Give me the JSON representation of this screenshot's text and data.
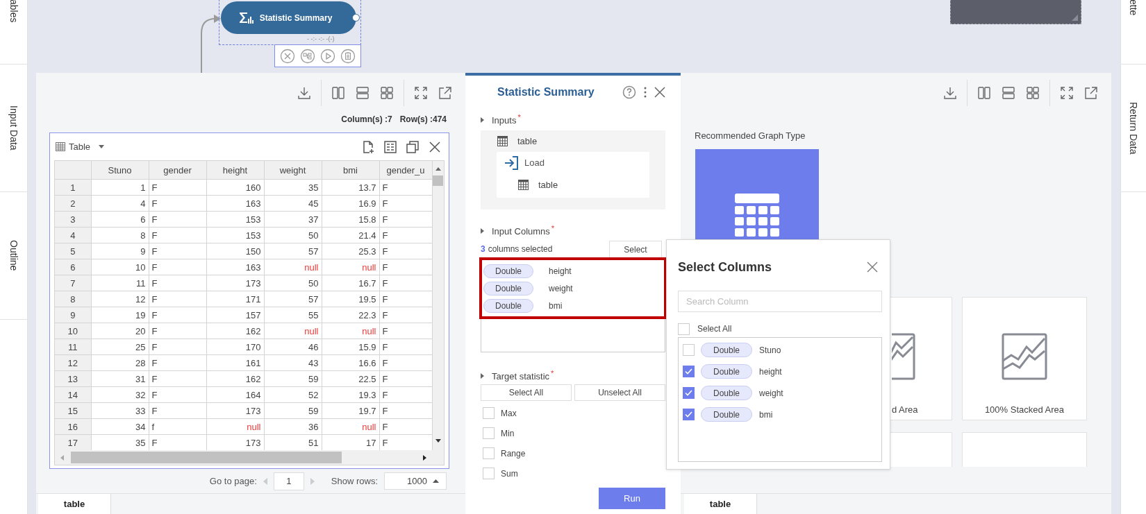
{
  "left_sidebar": {
    "tabs": [
      {
        "label": "ables"
      },
      {
        "label": "Input Data"
      },
      {
        "label": "Outline"
      }
    ]
  },
  "canvas": {
    "node": {
      "label": "Statistic Summary",
      "status": "- -:- -:- -(-)",
      "selected": true
    }
  },
  "data_panel": {
    "summary": {
      "columns": "Column(s) :7",
      "rows": "Row(s) :474"
    },
    "table_widget": {
      "title": "Table",
      "columns": [
        {
          "label": "Stuno",
          "kind": "number"
        },
        {
          "label": "gender",
          "kind": "text"
        },
        {
          "label": "height",
          "kind": "number"
        },
        {
          "label": "weight",
          "kind": "number"
        },
        {
          "label": "bmi",
          "kind": "number"
        },
        {
          "label": "gender_u",
          "kind": "text"
        }
      ],
      "rows": [
        {
          "index": "1",
          "cells": [
            "1",
            "F",
            "160",
            "35",
            "13.7",
            "F"
          ]
        },
        {
          "index": "2",
          "cells": [
            "4",
            "F",
            "163",
            "45",
            "16.9",
            "F"
          ]
        },
        {
          "index": "3",
          "cells": [
            "6",
            "F",
            "153",
            "37",
            "15.8",
            "F"
          ]
        },
        {
          "index": "4",
          "cells": [
            "8",
            "F",
            "153",
            "50",
            "21.4",
            "F"
          ]
        },
        {
          "index": "5",
          "cells": [
            "9",
            "F",
            "150",
            "57",
            "25.3",
            "F"
          ]
        },
        {
          "index": "6",
          "cells": [
            "10",
            "F",
            "163",
            {
              "text": "null",
              "missing": true
            },
            {
              "text": "null",
              "missing": true
            },
            "F"
          ]
        },
        {
          "index": "7",
          "cells": [
            "11",
            "F",
            "173",
            "50",
            "16.7",
            "F"
          ]
        },
        {
          "index": "8",
          "cells": [
            "12",
            "F",
            "171",
            "57",
            "19.5",
            "F"
          ]
        },
        {
          "index": "9",
          "cells": [
            "19",
            "F",
            "157",
            "55",
            "22.3",
            "F"
          ]
        },
        {
          "index": "10",
          "cells": [
            "20",
            "F",
            "162",
            {
              "text": "null",
              "missing": true
            },
            {
              "text": "null",
              "missing": true
            },
            "F"
          ]
        },
        {
          "index": "11",
          "cells": [
            "25",
            "F",
            "170",
            "46",
            "15.9",
            "F"
          ]
        },
        {
          "index": "12",
          "cells": [
            "28",
            "F",
            "161",
            "43",
            "16.6",
            "F"
          ]
        },
        {
          "index": "13",
          "cells": [
            "31",
            "F",
            "162",
            "59",
            "22.5",
            "F"
          ]
        },
        {
          "index": "14",
          "cells": [
            "32",
            "F",
            "164",
            "52",
            "19.3",
            "F"
          ]
        },
        {
          "index": "15",
          "cells": [
            "33",
            "F",
            "173",
            "59",
            "19.7",
            "F"
          ]
        },
        {
          "index": "16",
          "cells": [
            "34",
            "f",
            {
              "text": "null",
              "missing": true
            },
            "36",
            {
              "text": "null",
              "missing": true
            },
            "F"
          ]
        },
        {
          "index": "17",
          "cells": [
            "35",
            "F",
            "173",
            "51",
            "17",
            "F"
          ]
        }
      ]
    },
    "pager": {
      "page_label": "Go to page:",
      "page": "1",
      "rows_label": "Show rows:",
      "rows": "1000"
    },
    "bottom_tabs": [
      {
        "label": "table",
        "selected": true
      }
    ]
  },
  "settings_panel": {
    "title": "Statistic Summary",
    "inputs": {
      "label": "Inputs",
      "required_mark": "*",
      "tree": [
        {
          "label": "table",
          "kind": "table",
          "children": [
            {
              "label": "Load",
              "kind": "load",
              "children": [
                {
                  "label": "table",
                  "kind": "table"
                }
              ]
            }
          ]
        }
      ]
    },
    "input_columns": {
      "label": "Input Columns",
      "required_mark": "*",
      "count": "3",
      "count_label": "columns selected",
      "select_button": "Select",
      "highlighted": true,
      "selected": [
        {
          "type": "Double",
          "name": "height"
        },
        {
          "type": "Double",
          "name": "weight"
        },
        {
          "type": "Double",
          "name": "bmi"
        }
      ]
    },
    "target_statistic": {
      "label": "Target statistic",
      "required_mark": "*",
      "select_all": "Select All",
      "unselect_all": "Unselect All",
      "options": [
        {
          "label": "Max",
          "checked": false
        },
        {
          "label": "Min",
          "checked": false
        },
        {
          "label": "Range",
          "checked": false
        },
        {
          "label": "Sum",
          "checked": false
        }
      ]
    },
    "run_button": "Run"
  },
  "select_columns_dialog": {
    "title": "Select Columns",
    "search_placeholder": "Search Column",
    "select_all": {
      "label": "Select All",
      "checked": false
    },
    "columns": [
      {
        "type": "Double",
        "name": "Stuno",
        "checked": false
      },
      {
        "type": "Double",
        "name": "height",
        "checked": true
      },
      {
        "type": "Double",
        "name": "weight",
        "checked": true
      },
      {
        "type": "Double",
        "name": "bmi",
        "checked": true
      }
    ]
  },
  "graph_panel": {
    "heading": "Recommended Graph Type",
    "cards": [
      {
        "label": "d Area",
        "kind": "stacked-area"
      },
      {
        "label": "100% Stacked Area",
        "kind": "percent-stacked-area"
      },
      {
        "kind": "blank"
      },
      {
        "kind": "blank"
      }
    ],
    "bottom_tabs": [
      {
        "label": "table",
        "selected": true
      }
    ]
  },
  "right_sidebar": {
    "tabs": [
      {
        "label": "ette"
      },
      {
        "label": "Return Data"
      }
    ]
  }
}
